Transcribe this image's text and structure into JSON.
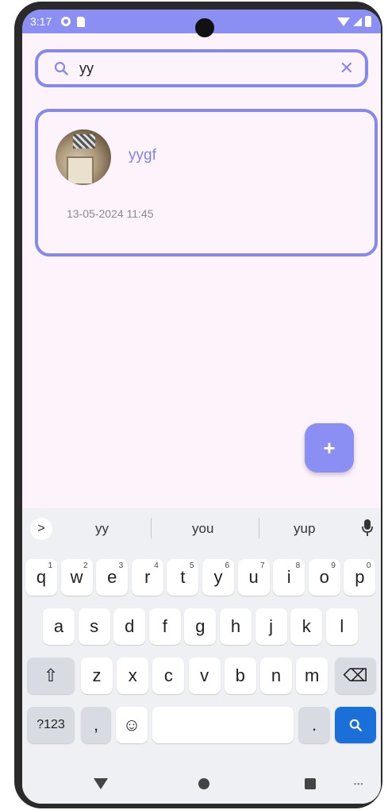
{
  "status_bar": {
    "time": "3:17",
    "icons": [
      "gear-icon",
      "sd-card-icon",
      "wifi-icon",
      "signal-icon",
      "battery-icon"
    ]
  },
  "search": {
    "value": "yy",
    "search_icon": "search-icon",
    "clear_icon": "close-icon",
    "clear_glyph": "✕"
  },
  "card": {
    "title": "yygf",
    "timestamp": "13-05-2024 11:45",
    "avatar": "avatar-image"
  },
  "fab": {
    "glyph": "+",
    "icon": "add-icon"
  },
  "keyboard": {
    "suggestions": [
      "yy",
      "you",
      "yup"
    ],
    "expand_glyph": ">",
    "row1": [
      {
        "k": "q",
        "n": "1"
      },
      {
        "k": "w",
        "n": "2"
      },
      {
        "k": "e",
        "n": "3"
      },
      {
        "k": "r",
        "n": "4"
      },
      {
        "k": "t",
        "n": "5"
      },
      {
        "k": "y",
        "n": "6"
      },
      {
        "k": "u",
        "n": "7"
      },
      {
        "k": "i",
        "n": "8"
      },
      {
        "k": "o",
        "n": "9"
      },
      {
        "k": "p",
        "n": "0"
      }
    ],
    "row2": [
      "a",
      "s",
      "d",
      "f",
      "g",
      "h",
      "j",
      "k",
      "l"
    ],
    "row3": [
      "z",
      "x",
      "c",
      "v",
      "b",
      "n",
      "m"
    ],
    "shift_glyph": "⇧",
    "backspace_glyph": "⌫",
    "symbols_label": "?123",
    "comma_label": ",",
    "emoji_glyph": "☺",
    "period_label": ".",
    "search_key_icon": "search-icon"
  },
  "colors": {
    "accent": "#8b8ff3",
    "outline": "#8589ef",
    "background": "#fdf4fb",
    "keyboard_bg": "#eef0f4",
    "search_key": "#1a6fd8"
  }
}
